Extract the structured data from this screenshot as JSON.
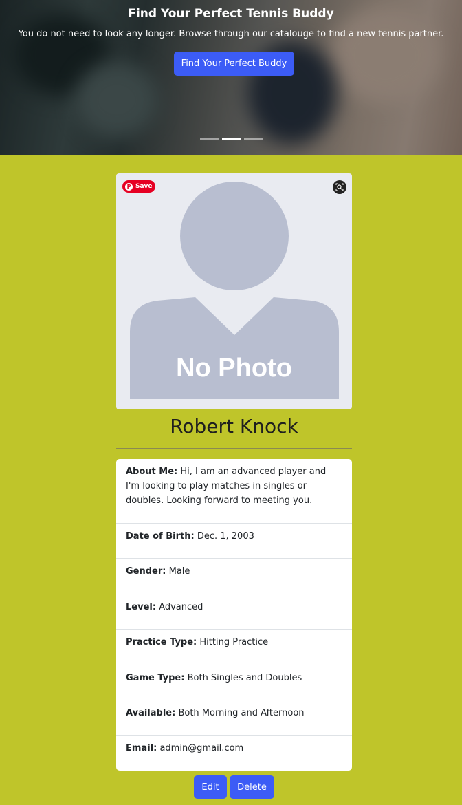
{
  "hero": {
    "title": "Find Your Perfect Tennis Buddy",
    "subtitle": "You do not need to look any longer. Browse through our catalouge to find a new tennis partner.",
    "cta_label": "Find Your Perfect Buddy",
    "slides": 3,
    "active_slide": 2
  },
  "photo": {
    "placeholder_text": "No Photo",
    "pin_save_label": "Save"
  },
  "profile": {
    "name": "Robert Knock",
    "fields": [
      {
        "label": "About Me:",
        "value": "Hi, I am an advanced player and I'm looking to play matches in singles or doubles. Looking forward to meeting you."
      },
      {
        "label": "Date of Birth:",
        "value": "Dec. 1, 2003"
      },
      {
        "label": "Gender:",
        "value": "Male"
      },
      {
        "label": "Level:",
        "value": "Advanced"
      },
      {
        "label": "Practice Type:",
        "value": "Hitting Practice"
      },
      {
        "label": "Game Type:",
        "value": "Both Singles and Doubles"
      },
      {
        "label": "Available:",
        "value": "Both Morning and Afternoon"
      },
      {
        "label": "Email:",
        "value": "admin@gmail.com"
      }
    ]
  },
  "actions": {
    "edit_label": "Edit",
    "delete_label": "Delete"
  },
  "colors": {
    "page_bg": "#bfc52a",
    "primary": "#3c5cf6",
    "avatar": "#b8bed0",
    "pinterest": "#e60023"
  }
}
